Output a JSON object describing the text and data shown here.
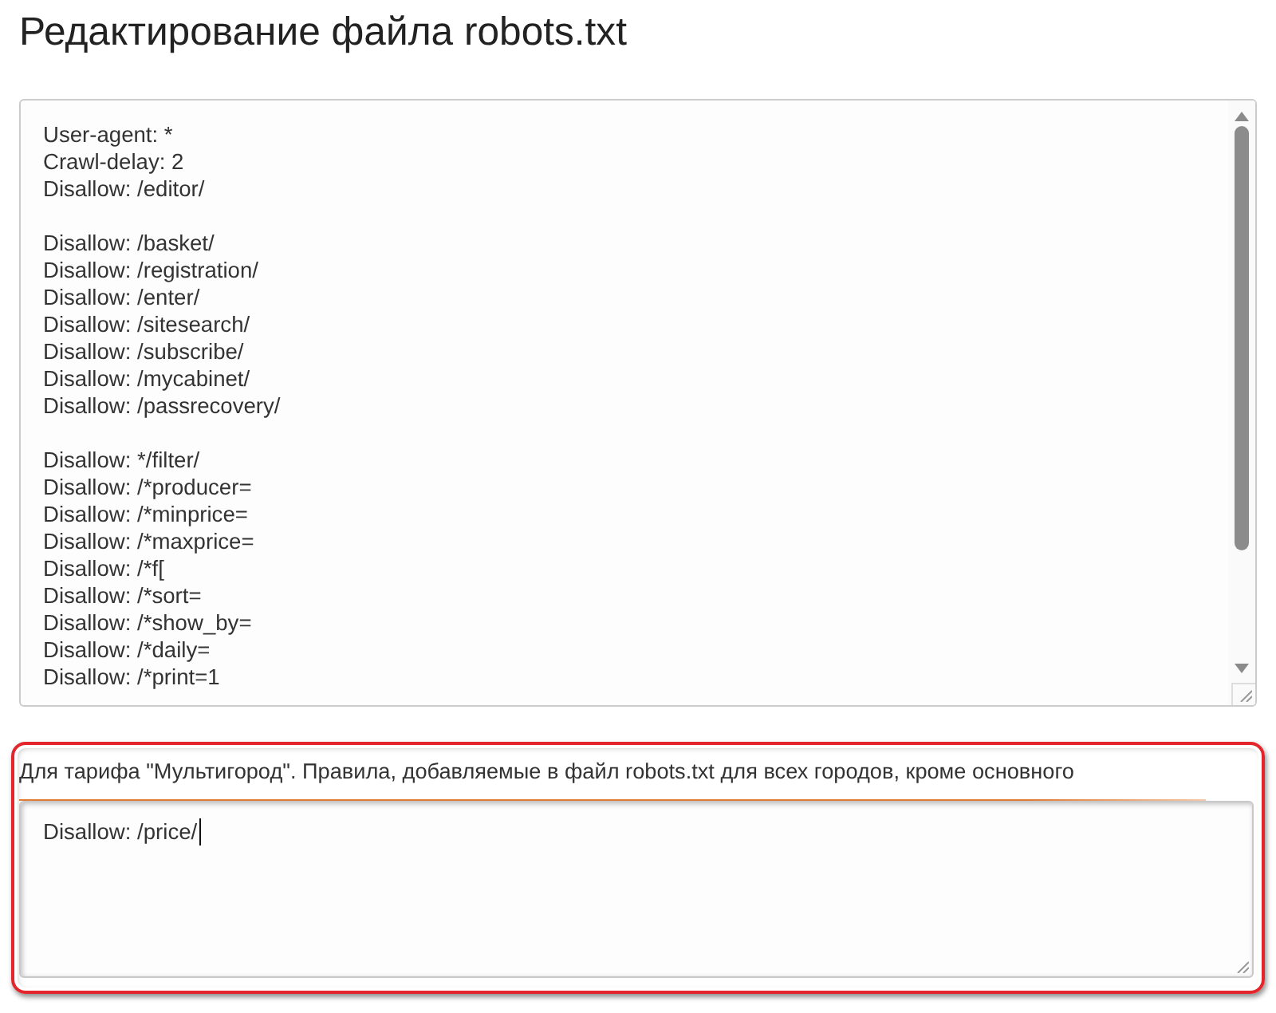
{
  "page": {
    "title": "Редактирование файла robots.txt"
  },
  "main_editor": {
    "blocks": [
      [
        "User-agent: *",
        "Crawl-delay: 2",
        "Disallow: /editor/"
      ],
      [
        "Disallow: /basket/",
        "Disallow: /registration/",
        "Disallow: /enter/",
        "Disallow: /sitesearch/",
        "Disallow: /subscribe/",
        "Disallow: /mycabinet/",
        "Disallow: /passrecovery/"
      ],
      [
        "Disallow: */filter/",
        "Disallow: /*producer=",
        "Disallow: /*minprice=",
        "Disallow: /*maxprice=",
        "Disallow: /*f[",
        "Disallow: /*sort=",
        "Disallow: /*show_by=",
        "Disallow: /*daily=",
        "Disallow: /*print=1"
      ]
    ]
  },
  "multicity": {
    "highlighted": true,
    "label": "Для тарифа \"Мультигород\". Правила, добавляемые в файл robots.txt для всех городов, кроме основного",
    "value": "Disallow: /price/",
    "focused": true
  }
}
